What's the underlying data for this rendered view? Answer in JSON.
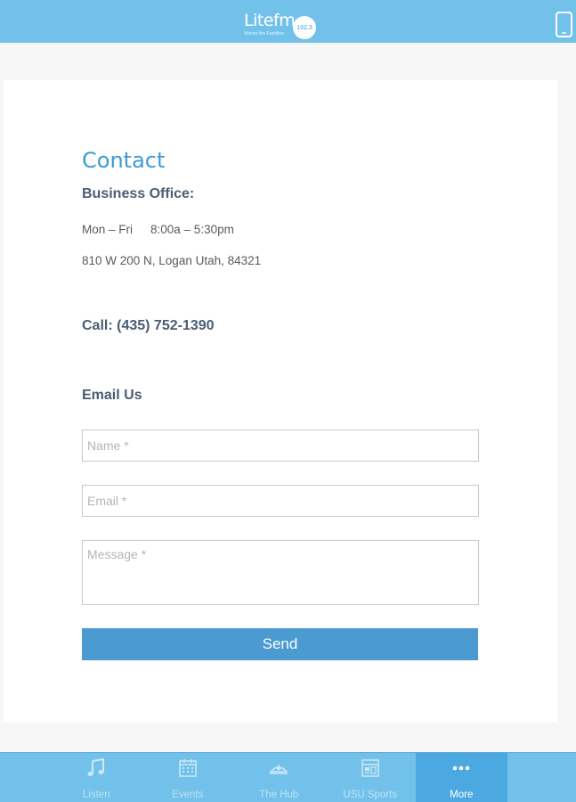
{
  "header": {
    "logo_text": "Litefm",
    "logo_tagline": "Voices the Families",
    "logo_badge": "102.3",
    "device_icon": "phone-device-icon"
  },
  "contact": {
    "title": "Contact",
    "office_label": "Business Office:",
    "hours_days": "Mon – Fri",
    "hours_time": "8:00a – 5:30pm",
    "address": "810 W 200 N, Logan Utah, 84321",
    "call": "Call: (435) 752-1390",
    "email_heading": "Email Us"
  },
  "form": {
    "name_placeholder": "Name *",
    "email_placeholder": "Email *",
    "message_placeholder": "Message *",
    "send_label": "Send"
  },
  "tabs": [
    {
      "label": "Listen",
      "icon": "music-note-icon",
      "active": false
    },
    {
      "label": "Events",
      "icon": "calendar-icon",
      "active": false
    },
    {
      "label": "The Hub",
      "icon": "hub-icon",
      "active": false
    },
    {
      "label": "USU Sports",
      "icon": "sports-grid-icon",
      "active": false
    },
    {
      "label": "More",
      "icon": "more-dots-icon",
      "active": true
    }
  ],
  "colors": {
    "header_bg": "#72c1ea",
    "accent": "#3d9bd3",
    "button": "#4b9ad2",
    "active_tab": "#4ba8e1"
  }
}
